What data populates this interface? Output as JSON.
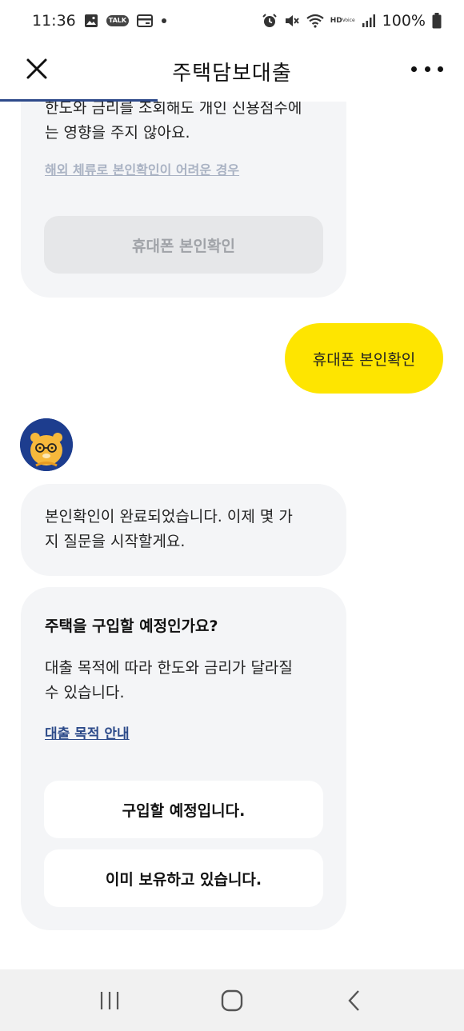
{
  "status_bar": {
    "time": "11:36",
    "talk_badge": "TALK",
    "hd_label": "HD",
    "voice_label": "Voice",
    "battery_text": "100%",
    "icons": [
      "gallery-icon",
      "talk-icon",
      "card-icon",
      "dot-icon",
      "alarm-icon",
      "mute-icon",
      "wifi-icon",
      "hd-voice-icon",
      "signal-icon",
      "battery-icon"
    ]
  },
  "header": {
    "title": "주택담보대출",
    "progress_fraction": 0.34
  },
  "chat": {
    "auth_card": {
      "text_line1": "한도와 금리를 조회해도 개인 신용점수에",
      "text_line2": "는 영향을 주지 않아요.",
      "overseas_link": "해외 체류로 본인확인이 어려운 경우",
      "phone_button": "휴대폰 본인확인"
    },
    "user_reply": "휴대폰 본인확인",
    "bot_message": {
      "line1": "본인확인이 완료되었습니다. 이제 몇 가",
      "line2": "지 질문을 시작할게요."
    },
    "question_card": {
      "title": "주택을 구입할 예정인가요?",
      "desc_line1": "대출 목적에 따라 한도와 금리가 달라질",
      "desc_line2": "수 있습니다.",
      "guide_link": "대출 목적 안내",
      "options": [
        {
          "label": "구입할 예정입니다."
        },
        {
          "label": "이미 보유하고 있습니다."
        }
      ]
    }
  },
  "colors": {
    "accent_yellow": "#fee500",
    "brand_navy": "#1d3d8e",
    "bubble_gray": "#f4f5f7",
    "link_blue": "#2d4b8a"
  },
  "nav": {
    "icons": [
      "recent-apps-icon",
      "home-icon",
      "back-icon"
    ]
  }
}
